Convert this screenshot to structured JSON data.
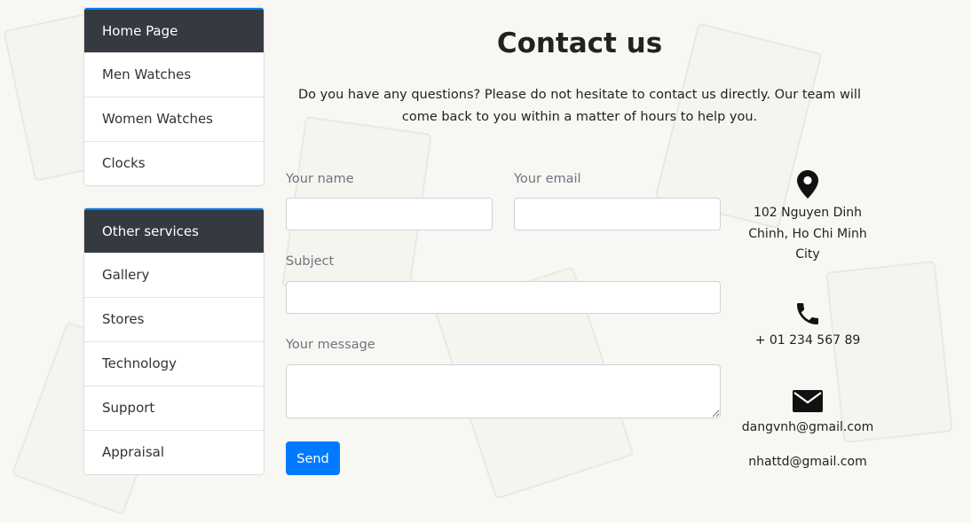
{
  "sidebar": {
    "main_menu": [
      {
        "label": "Home Page",
        "active": true
      },
      {
        "label": "Men Watches"
      },
      {
        "label": "Women Watches"
      },
      {
        "label": "Clocks"
      }
    ],
    "services_menu": [
      {
        "label": "Other services",
        "active": true
      },
      {
        "label": "Gallery"
      },
      {
        "label": "Stores"
      },
      {
        "label": "Technology"
      },
      {
        "label": "Support"
      },
      {
        "label": "Appraisal"
      }
    ]
  },
  "page": {
    "title": "Contact us",
    "intro": "Do you have any questions? Please do not hesitate to contact us directly. Our team will come back to you within a matter of hours to help you."
  },
  "form": {
    "name_label": "Your name",
    "name_value": "",
    "email_label": "Your email",
    "email_value": "",
    "subject_label": "Subject",
    "subject_value": "",
    "message_label": "Your message",
    "message_value": "",
    "send_label": "Send"
  },
  "contact": {
    "address": "102 Nguyen Dinh Chinh, Ho Chi Minh City",
    "address_icon": "map-marker-icon",
    "phone": "+ 01 234 567 89",
    "phone_icon": "phone-icon",
    "emails": [
      "dangvnh@gmail.com",
      "nhattd@gmail.com"
    ],
    "email_icon": "envelope-icon"
  },
  "colors": {
    "accent": "#007bff",
    "menu_header": "#343a40",
    "background": "#f8f7f3"
  }
}
